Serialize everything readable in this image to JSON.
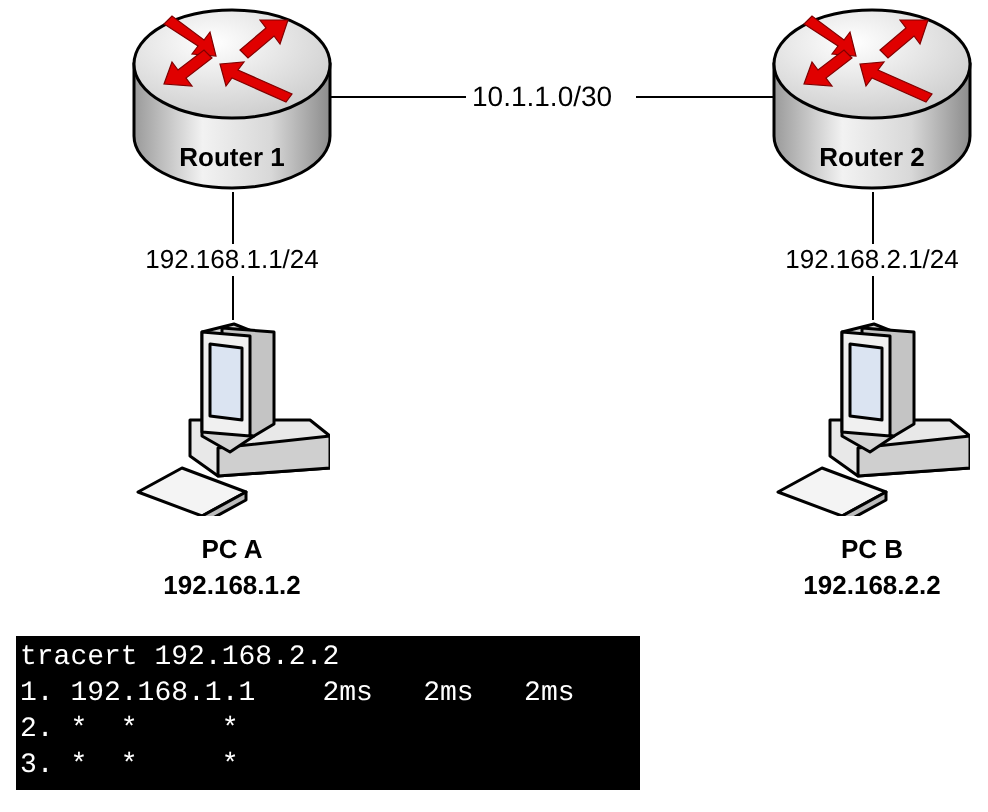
{
  "router_link": {
    "label": "10.1.1.0/30"
  },
  "sites": [
    {
      "router": "Router 1",
      "gateway": "192.168.1.1/24",
      "pc_name": "PC A",
      "pc_ip": "192.168.1.2"
    },
    {
      "router": "Router 2",
      "gateway": "192.168.2.1/24",
      "pc_name": "PC B",
      "pc_ip": "192.168.2.2"
    }
  ],
  "terminal": {
    "lines": [
      "tracert 192.168.2.2",
      "1. 192.168.1.1    2ms   2ms   2ms",
      "2. *  *     *",
      "3. *  *     *"
    ]
  }
}
